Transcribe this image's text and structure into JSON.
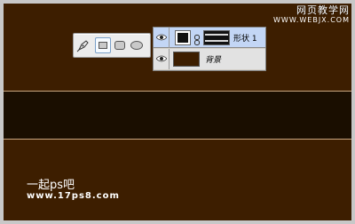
{
  "watermark_top": {
    "site_name": "网页教学网",
    "url": "WWW.WEBJX.COM"
  },
  "watermark_bottom": {
    "site_name": "一起ps吧",
    "url": "www.17ps8.com"
  },
  "toolbar": {
    "tools": [
      {
        "icon": "pen-icon"
      },
      {
        "icon": "rectangle-icon",
        "selected": true
      },
      {
        "icon": "rounded-rectangle-icon"
      },
      {
        "icon": "ellipse-icon"
      }
    ]
  },
  "layers": [
    {
      "name": "形状 1",
      "selected": true,
      "visible": true,
      "thumbnail_color": "#111111"
    },
    {
      "name": "背景",
      "selected": false,
      "visible": true,
      "thumbnail_color": "#3d1e00"
    }
  ],
  "colors": {
    "canvas": "#3d1e00",
    "band": "#1a0e00",
    "selected_layer": "#c3d6f5"
  }
}
